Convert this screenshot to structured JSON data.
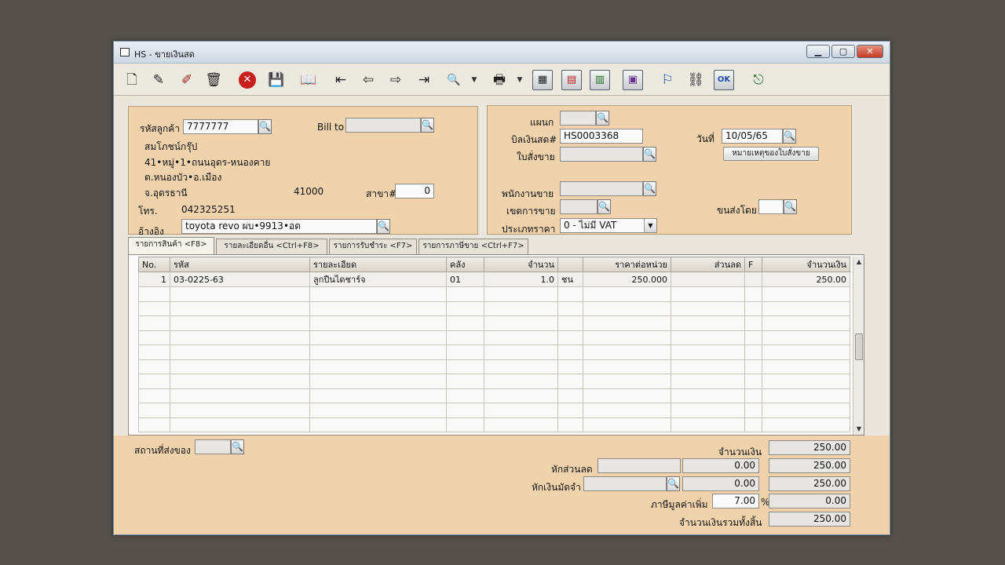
{
  "window": {
    "title": "HS - ขายเงินสด"
  },
  "toolbar": {
    "buttons": [
      {
        "name": "new-doc-icon",
        "glyph": "🗋"
      },
      {
        "name": "edit-icon",
        "glyph": "✎"
      },
      {
        "name": "edit-red-icon",
        "glyph": "✐"
      },
      {
        "name": "trash-icon",
        "glyph": "🗑"
      },
      {
        "name": "cancel-icon",
        "glyph": "✕"
      },
      {
        "name": "save-disk-icon",
        "glyph": "💾"
      },
      {
        "name": "book-icon",
        "glyph": "📖"
      },
      {
        "name": "first-record-icon",
        "glyph": "⇤"
      },
      {
        "name": "prev-record-icon",
        "glyph": "⇦"
      },
      {
        "name": "next-record-icon",
        "glyph": "⇨"
      },
      {
        "name": "last-record-icon",
        "glyph": "⇥"
      },
      {
        "name": "search-doc-icon",
        "glyph": "🔍"
      },
      {
        "name": "printer-icon",
        "glyph": "🖶"
      },
      {
        "name": "calculator-icon",
        "glyph": "▦"
      },
      {
        "name": "screen-red-icon",
        "glyph": "▤"
      },
      {
        "name": "chart-screen-icon",
        "glyph": "▥"
      },
      {
        "name": "calendar-icon",
        "glyph": "▣"
      },
      {
        "name": "flag-dc-icon",
        "glyph": "⚐"
      },
      {
        "name": "link-icon",
        "glyph": "⛓"
      },
      {
        "name": "ok-icon",
        "glyph": "OK"
      },
      {
        "name": "exit-icon",
        "glyph": "⎋"
      }
    ]
  },
  "customer": {
    "code_label": "รหัสลูกค้า",
    "code_value": "7777777",
    "bill_to_label": "Bill to",
    "bill_to_value": "",
    "name": "สมโภชน์กรุ๊ป",
    "address1": "41•หมู่•1•ถนนอุดร-หนองคาย",
    "address2": "ต.หนองบัว•อ.เมือง",
    "province": "จ.อุดรธานี",
    "postcode": "41000",
    "branch_label": "สาขา#",
    "branch_value": "0",
    "phone_label": "โทร.",
    "phone_value": "042325251",
    "ref_label": "อ้างอิง",
    "ref_value": "toyota revo ผบ•9913•อด"
  },
  "doc": {
    "dept_label": "แผนก",
    "dept_value": "",
    "bill_label": "บิลเงินสด#",
    "bill_value": "HS0003368",
    "date_label": "วันที่",
    "date_value": "10/05/65",
    "order_label": "ใบสั่งขาย",
    "order_value": "",
    "note_button": "หมายเหตุของใบสั่งขาย",
    "salesman_label": "พนักงานขาย",
    "salesman_value": "",
    "area_label": "เขตการขาย",
    "area_value": "",
    "ship_label": "ขนส่งโดย",
    "ship_value": "",
    "price_type_label": "ประเภทราคา",
    "price_type_value": "0 - ไม่มี VAT"
  },
  "tabs": [
    {
      "label": "รายการสินค้า <F8>"
    },
    {
      "label": "รายละเอียดอื่น <Ctrl+F8>"
    },
    {
      "label": "รายการรับชำระ <F7>"
    },
    {
      "label": "รายการภาษีขาย <Ctrl+F7>"
    }
  ],
  "grid": {
    "headers": [
      "No.",
      "รหัส",
      "รายละเอียด",
      "คลัง",
      "จำนวน",
      "",
      "ราคาต่อหน่วย",
      "ส่วนลด",
      "F",
      "จำนวนเงิน"
    ],
    "rows": [
      [
        "1",
        "03-0225-63",
        "ลูกปืนไดชาร์จ",
        "01",
        "1.0",
        "ชน",
        "250.000",
        "",
        "",
        "250.00"
      ]
    ],
    "empty_rows": 10
  },
  "footer": {
    "delivery_label": "สถานที่ส่งของ",
    "delivery_value": "",
    "amount_label": "จำนวนเงิน",
    "amount_value": "250.00",
    "discount_label": "หักส่วนลด",
    "discount_text": "",
    "discount_amount": "0.00",
    "after_discount": "250.00",
    "deposit_label": "หักเงินมัดจำ",
    "deposit_text": "",
    "deposit_amount": "0.00",
    "after_deposit": "250.00",
    "vat_label": "ภาษีมูลค่าเพิ่ม",
    "vat_rate": "7.00",
    "vat_percent": "%",
    "vat_amount": "0.00",
    "total_label": "จำนวนเงินรวมทั้งสิ้น",
    "total_value": "250.00"
  }
}
